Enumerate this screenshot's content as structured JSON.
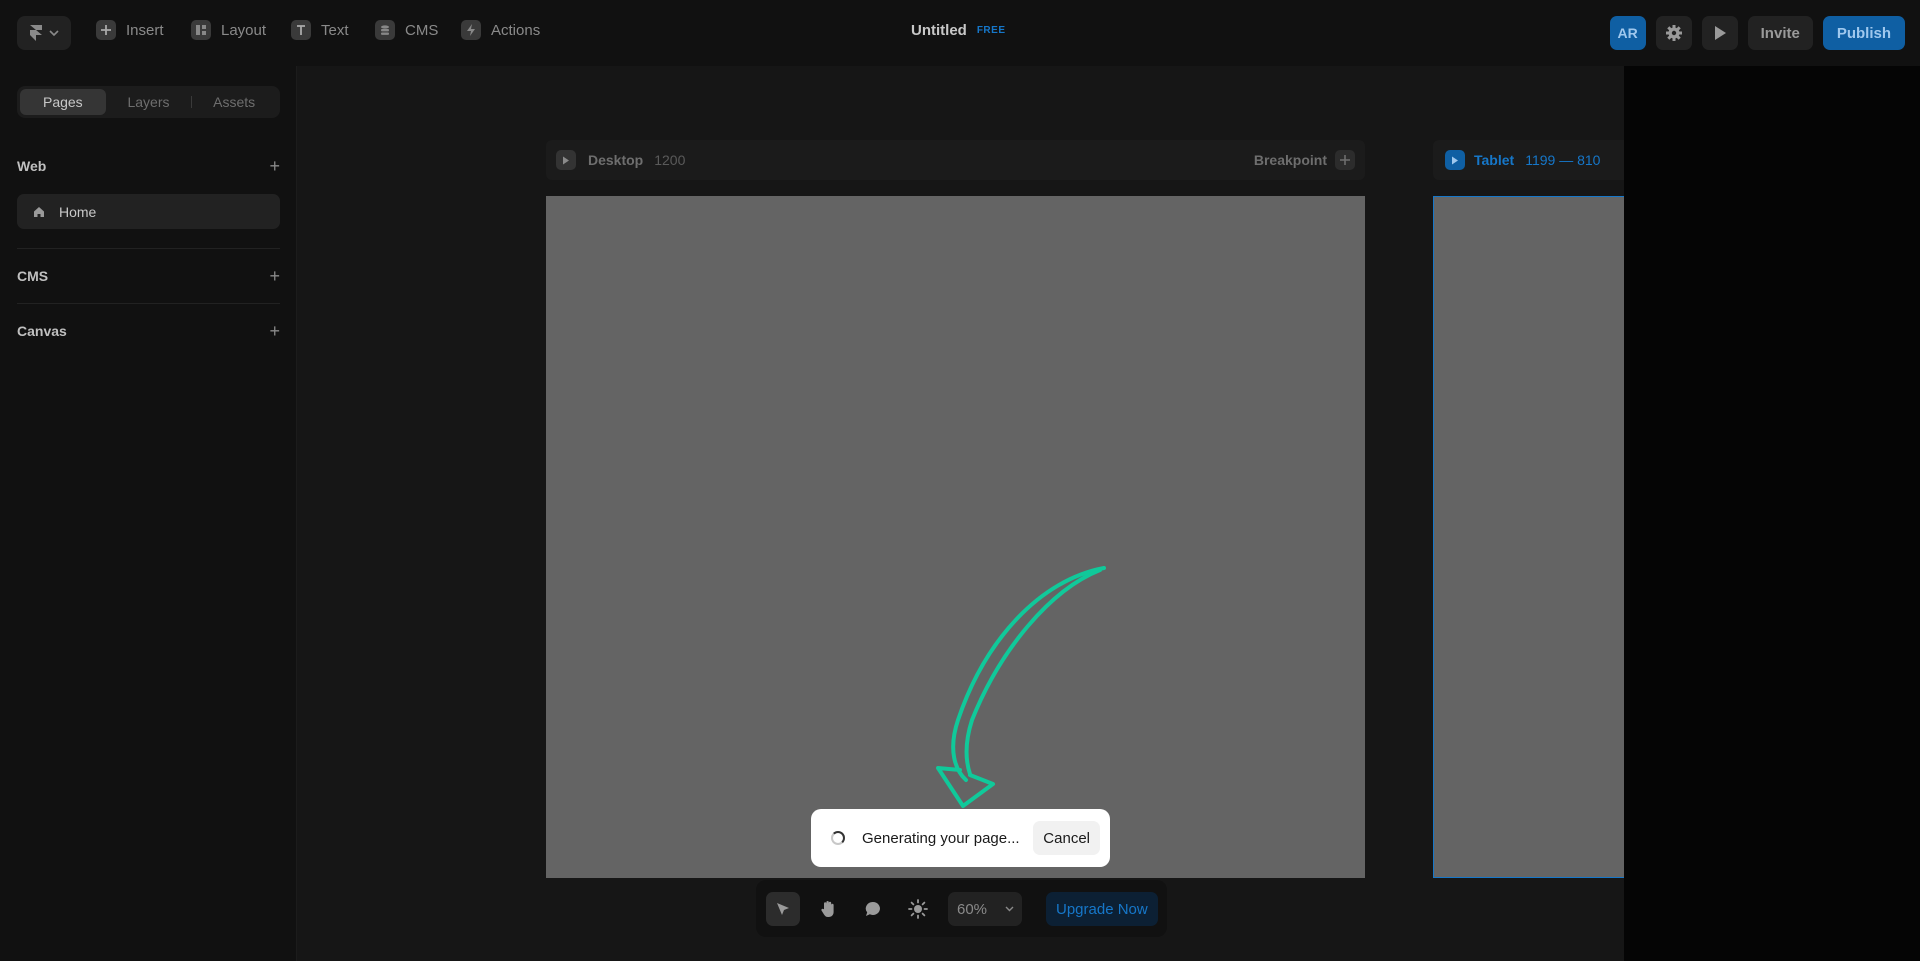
{
  "topbar": {
    "menu": [
      {
        "label": "Insert",
        "icon": "plus-square-icon"
      },
      {
        "label": "Layout",
        "icon": "layout-icon"
      },
      {
        "label": "Text",
        "icon": "text-icon"
      },
      {
        "label": "CMS",
        "icon": "database-icon"
      },
      {
        "label": "Actions",
        "icon": "bolt-icon"
      }
    ],
    "doc_title": "Untitled",
    "plan_badge": "FREE",
    "avatar_initials": "AR",
    "invite_label": "Invite",
    "publish_label": "Publish"
  },
  "sidebar": {
    "tabs": [
      "Pages",
      "Layers",
      "Assets"
    ],
    "active_tab": "Pages",
    "sections": [
      {
        "title": "Web"
      },
      {
        "title": "CMS"
      },
      {
        "title": "Canvas"
      }
    ],
    "pages": [
      {
        "label": "Home",
        "icon": "home-icon"
      }
    ]
  },
  "canvas": {
    "desktop": {
      "name": "Desktop",
      "size": "1200",
      "breakpoint_label": "Breakpoint"
    },
    "tablet": {
      "name": "Tablet",
      "size": "1199 — 810"
    }
  },
  "toast": {
    "message": "Generating your page...",
    "cancel_label": "Cancel"
  },
  "toolbar": {
    "tools": [
      "pointer-icon",
      "hand-icon",
      "comment-icon",
      "sun-icon"
    ],
    "zoom": "60%",
    "upgrade_label": "Upgrade Now"
  },
  "colors": {
    "accent": "#1677c9",
    "annotation_arrow": "#10c99a",
    "frame_fill": "#646464"
  }
}
